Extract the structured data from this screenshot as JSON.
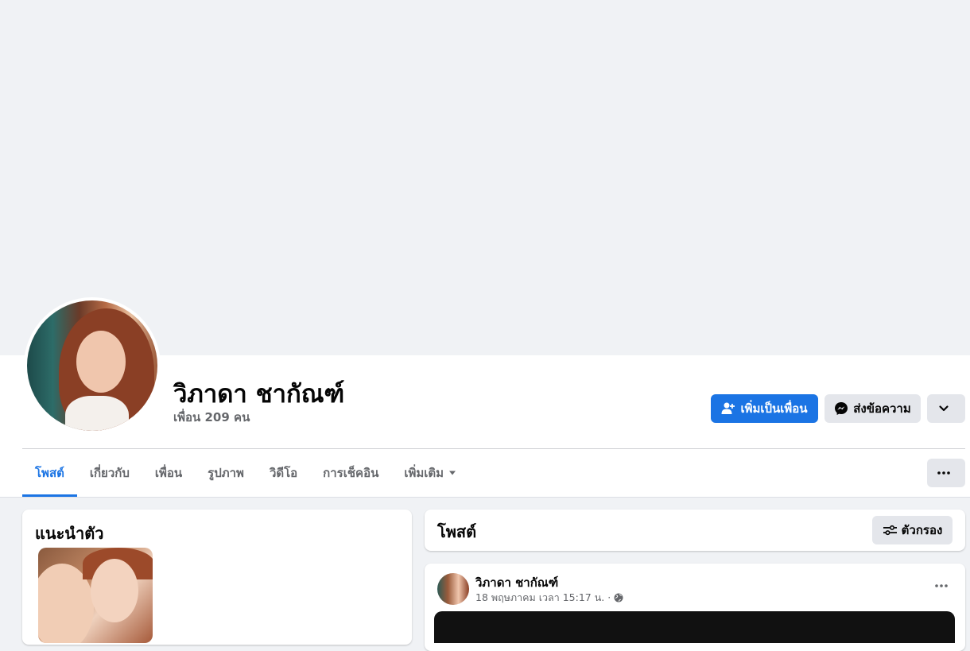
{
  "profile": {
    "name": "วิภาดา ชากัณฑ์",
    "friends": "เพื่อน 209 คน"
  },
  "actions": {
    "add_friend": "เพิ่มเป็นเพื่อน",
    "message": "ส่งข้อความ"
  },
  "tabs": [
    {
      "label": "โพสต์",
      "active": true
    },
    {
      "label": "เกี่ยวกับ"
    },
    {
      "label": "เพื่อน"
    },
    {
      "label": "รูปภาพ"
    },
    {
      "label": "วิดีโอ"
    },
    {
      "label": "การเช็คอิน"
    },
    {
      "label": "เพิ่มเติม"
    }
  ],
  "intro": {
    "title": "แนะนำตัว"
  },
  "posts": {
    "title": "โพสต์",
    "filter_label": "ตัวกรอง",
    "items": [
      {
        "author": "วิภาดา ชากัณฑ์",
        "date": "18 พฤษภาคม เวลา 15:17 น. ·",
        "privacy_icon": "globe-icon"
      }
    ]
  },
  "colors": {
    "accent": "#1b74e4",
    "background": "#f0f2f5",
    "secondary_button": "#e4e6eb",
    "secondary_text": "#65676b"
  }
}
